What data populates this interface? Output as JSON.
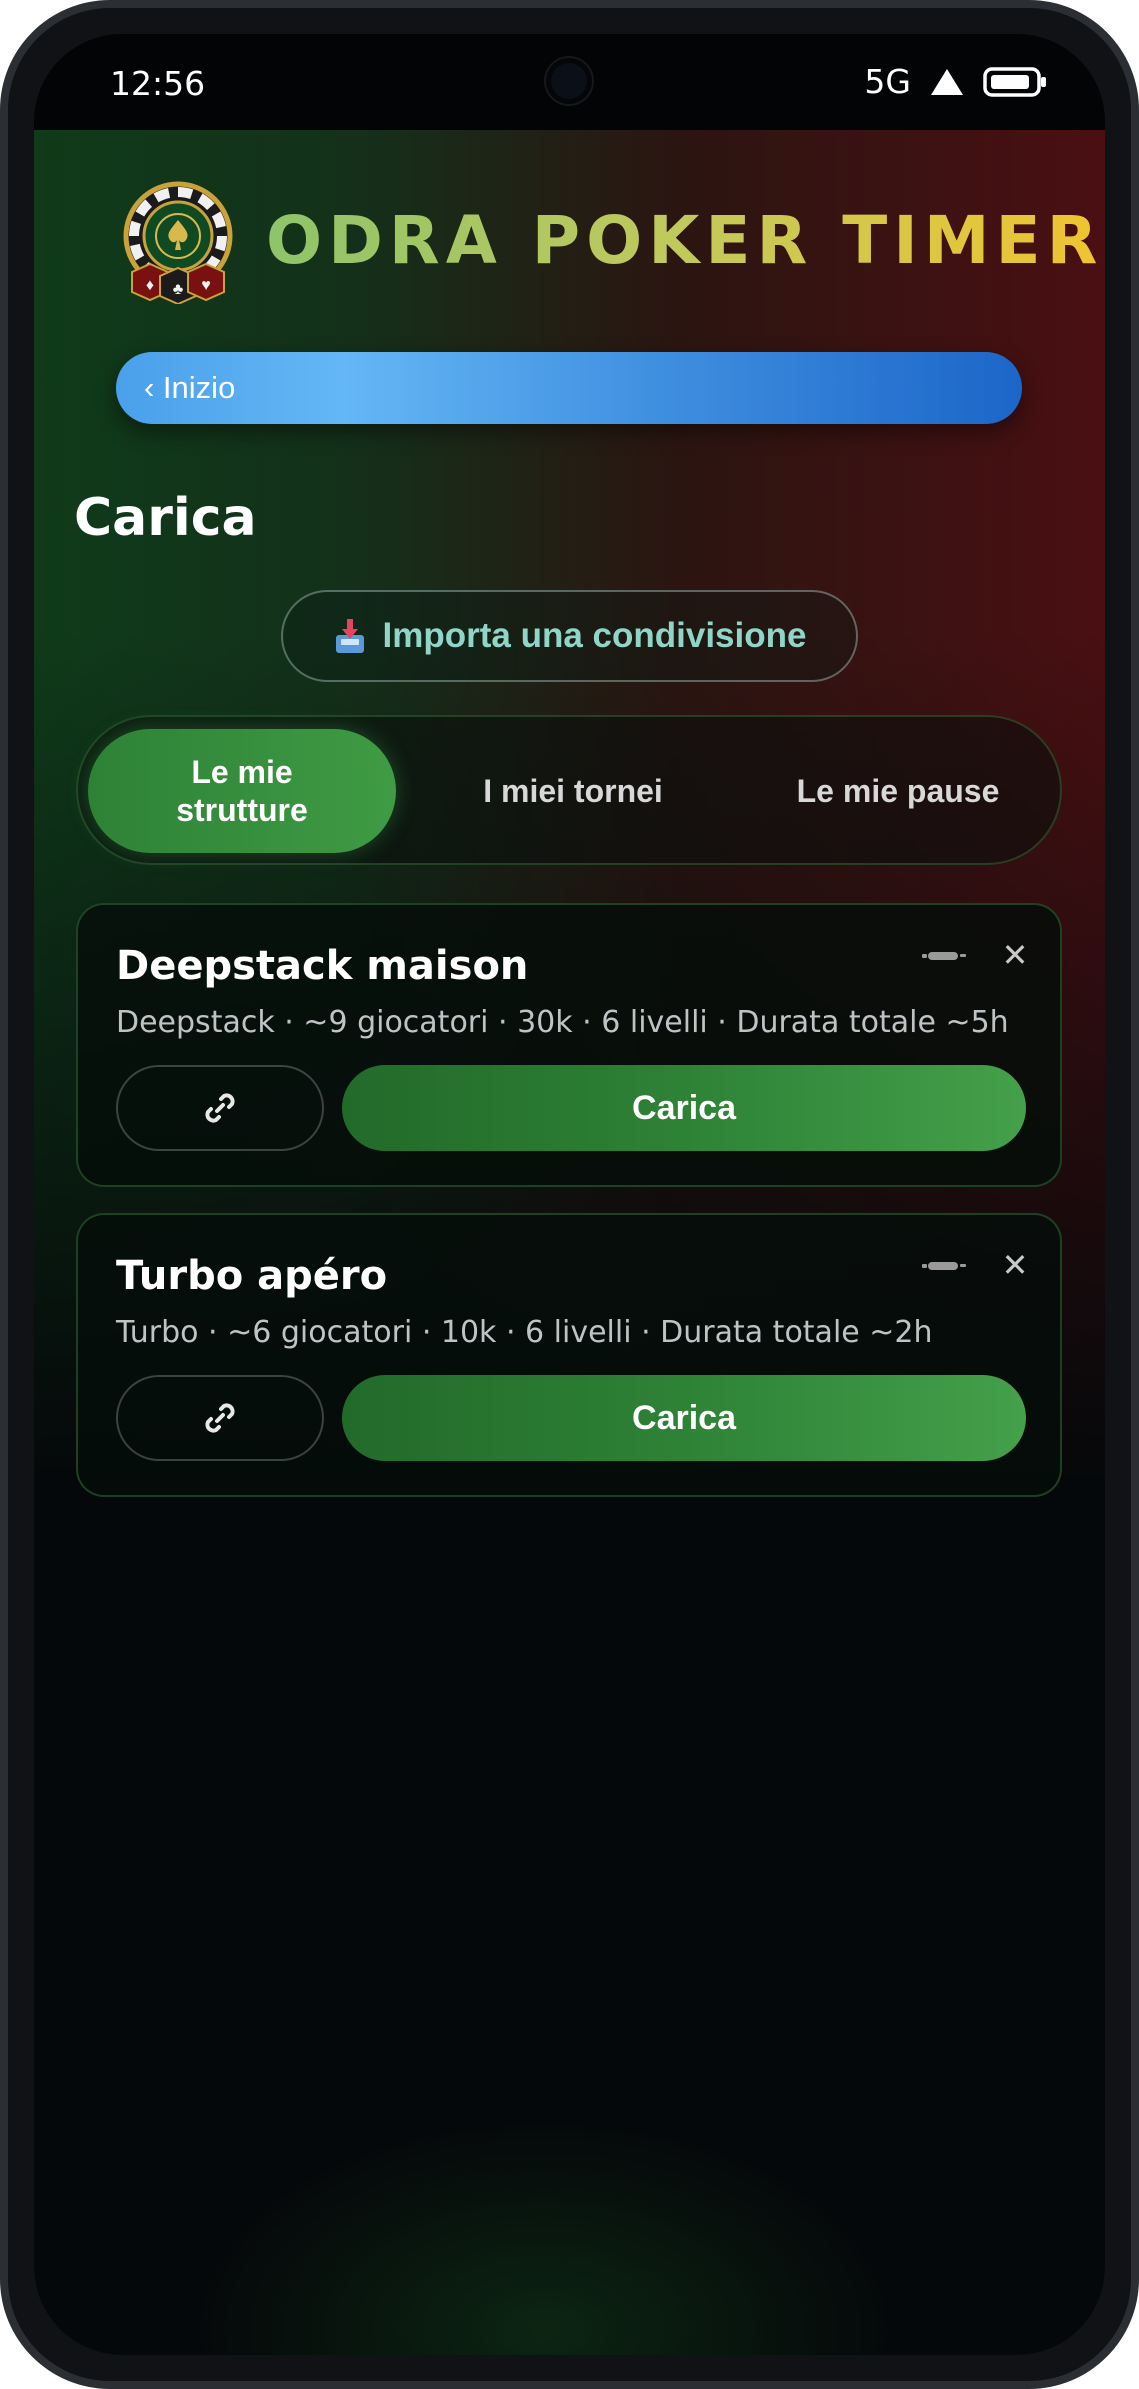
{
  "status_bar": {
    "time": "12:56",
    "network": "5G"
  },
  "header": {
    "title": "ODRA POKER TIMER"
  },
  "nav": {
    "back_label": "‹ Inizio"
  },
  "page": {
    "title": "Carica"
  },
  "import": {
    "icon": "inbox-tray-icon",
    "label": "Importa una condivisione"
  },
  "tabs": [
    {
      "label": "Le mie strutture",
      "active": true
    },
    {
      "label": "I miei tornei",
      "active": false
    },
    {
      "label": "Le mie pause",
      "active": false
    }
  ],
  "items": [
    {
      "title": "Deepstack maison",
      "meta": "Deepstack · ~9 giocatori · 30k · 6 livelli · Durata totale ~5h",
      "load_label": "Carica"
    },
    {
      "title": "Turbo apéro",
      "meta": "Turbo · ~6 giocatori · 10k · 6 livelli · Durata totale ~2h",
      "load_label": "Carica"
    }
  ],
  "colors": {
    "accent_green": "#3f9b44",
    "accent_blue": "#3f8fe0",
    "title_gold": "#f0c430",
    "import_text": "#8fd6c8"
  }
}
